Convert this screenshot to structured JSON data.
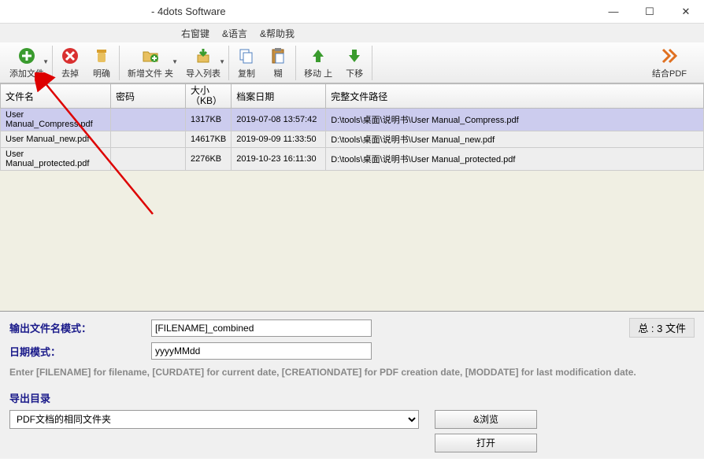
{
  "window": {
    "title": "- 4dots Software"
  },
  "menu": {
    "items": [
      "右窗键",
      "&语言",
      "&帮助我"
    ]
  },
  "toolbar": {
    "add_file": "添加文件",
    "remove": "去掉",
    "clear": "明确",
    "new_folder": "新增文件 夹",
    "import_list": "导入列表",
    "copy": "复制",
    "paste": "糊",
    "move_up": "移动 上",
    "move_down": "下移",
    "combine": "结合PDF"
  },
  "table": {
    "headers": {
      "filename": "文件名",
      "password": "密码",
      "size": "大小（KB）",
      "date": "档案日期",
      "path": "完整文件路径"
    },
    "rows": [
      {
        "filename": "User Manual_Compress.pdf",
        "password": "",
        "size": "1317KB",
        "date": "2019-07-08 13:57:42",
        "path": "D:\\tools\\桌面\\说明书\\User Manual_Compress.pdf"
      },
      {
        "filename": "User Manual_new.pdf",
        "password": "",
        "size": "14617KB",
        "date": "2019-09-09 11:33:50",
        "path": "D:\\tools\\桌面\\说明书\\User Manual_new.pdf"
      },
      {
        "filename": "User Manual_protected.pdf",
        "password": "",
        "size": "2276KB",
        "date": "2019-10-23 16:11:30",
        "path": "D:\\tools\\桌面\\说明书\\User Manual_protected.pdf"
      }
    ]
  },
  "form": {
    "output_pattern_label": "输出文件名模式：",
    "output_pattern_value": "[FILENAME]_combined",
    "date_pattern_label": "日期模式：",
    "date_pattern_value": "yyyyMMdd",
    "summary": "总 : 3 文件",
    "hint": "Enter [FILENAME] for filename, [CURDATE] for current date, [CREATIONDATE] for PDF creation date, [MODDATE] for last modification date.",
    "export_label": "导出目录",
    "export_value": "PDF文档的相同文件夹",
    "browse": "&浏览",
    "open": "打开"
  }
}
